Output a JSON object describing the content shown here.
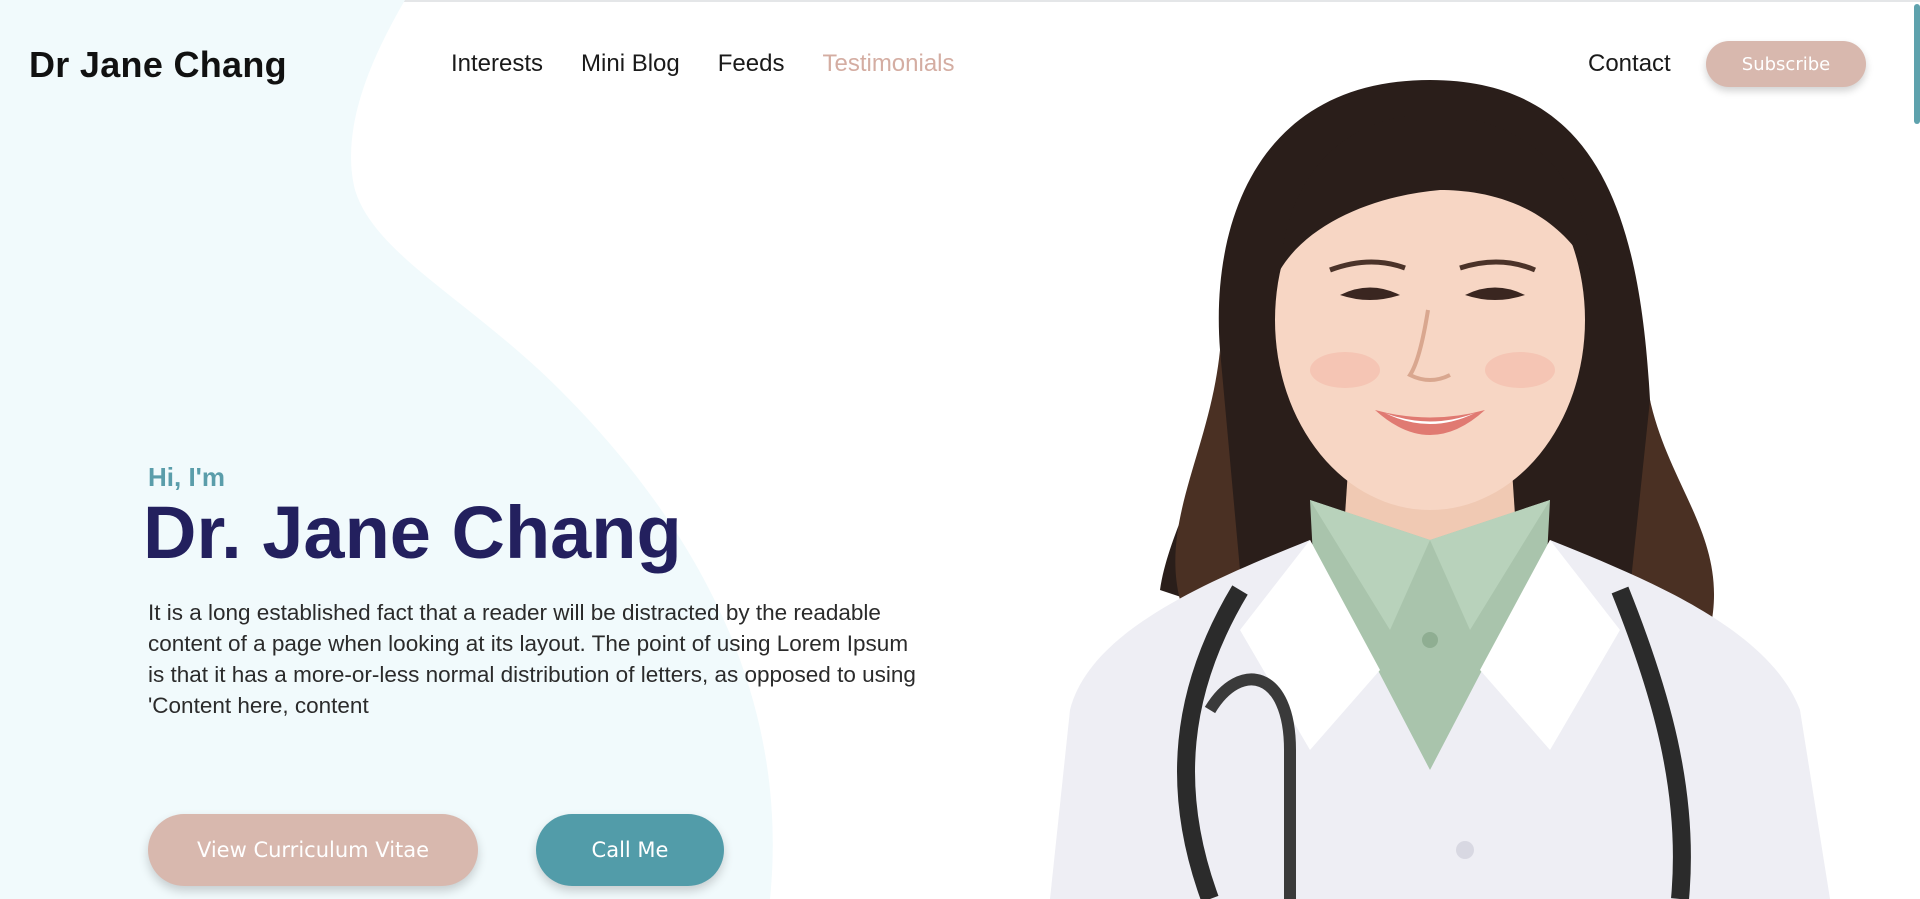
{
  "header": {
    "brand": "Dr Jane Chang",
    "nav": [
      {
        "label": "Interests",
        "active": false
      },
      {
        "label": "Mini Blog",
        "active": false
      },
      {
        "label": "Feeds",
        "active": false
      },
      {
        "label": "Testimonials",
        "active": true
      }
    ],
    "contact_label": "Contact",
    "subscribe_label": "Subscribe"
  },
  "hero": {
    "greeting": "Hi, I'm",
    "name": "Dr. Jane Chang",
    "description": "It is a long established fact that a reader will be distracted by the readable content of a page when looking at its layout. The point of using Lorem Ipsum is that it has a more-or-less normal distribution of letters, as opposed to using 'Content here, content",
    "cv_button_label": "View Curriculum Vitae",
    "call_button_label": "Call Me",
    "photo_icon": "doctor-portrait"
  },
  "colors": {
    "accent_pink": "#d8b8ae",
    "accent_teal": "#529ca9",
    "name_navy": "#23205e",
    "greeting_teal": "#5a9daa",
    "blob_bg": "#f1fafc"
  }
}
